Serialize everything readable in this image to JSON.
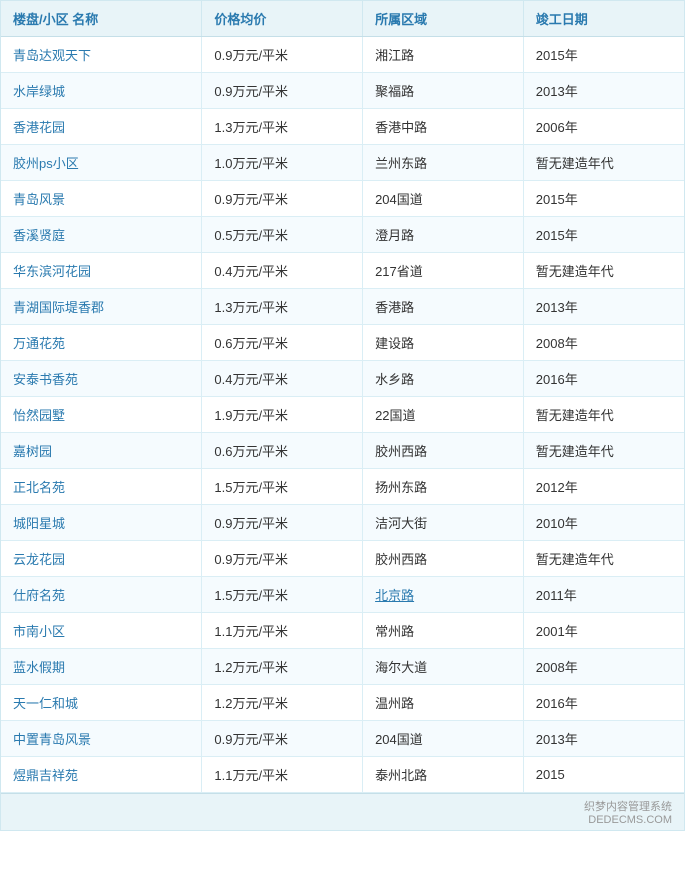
{
  "table": {
    "headers": [
      "楼盘/小区 名称",
      "价格均价",
      "所属区域",
      "竣工日期"
    ],
    "rows": [
      {
        "name": "青岛达观天下",
        "price": "0.9万元/平米",
        "area": "湘江路",
        "year": "2015年"
      },
      {
        "name": "水岸绿城",
        "price": "0.9万元/平米",
        "area": "聚福路",
        "year": "2013年"
      },
      {
        "name": "香港花园",
        "price": "1.3万元/平米",
        "area": "香港中路",
        "year": "2006年"
      },
      {
        "name": "胶州ps小区",
        "price": "1.0万元/平米",
        "area": "兰州东路",
        "year": "暂无建造年代"
      },
      {
        "name": "青岛风景",
        "price": "0.9万元/平米",
        "area": "204国道",
        "year": "2015年"
      },
      {
        "name": "香溪贤庭",
        "price": "0.5万元/平米",
        "area": "澄月路",
        "year": "2015年"
      },
      {
        "name": "华东滨河花园",
        "price": "0.4万元/平米",
        "area": "217省道",
        "year": "暂无建造年代"
      },
      {
        "name": "青湖国际堤香郡",
        "price": "1.3万元/平米",
        "area": "香港路",
        "year": "2013年"
      },
      {
        "name": "万通花苑",
        "price": "0.6万元/平米",
        "area": "建设路",
        "year": "2008年"
      },
      {
        "name": "安泰书香苑",
        "price": "0.4万元/平米",
        "area": "水乡路",
        "year": "2016年"
      },
      {
        "name": "怡然园墅",
        "price": "1.9万元/平米",
        "area": "22国道",
        "year": "暂无建造年代"
      },
      {
        "name": "嘉树园",
        "price": "0.6万元/平米",
        "area": "胶州西路",
        "year": "暂无建造年代"
      },
      {
        "name": "正北名苑",
        "price": "1.5万元/平米",
        "area": "扬州东路",
        "year": "2012年"
      },
      {
        "name": "城阳星城",
        "price": "0.9万元/平米",
        "area": "洁河大街",
        "year": "2010年"
      },
      {
        "name": "云龙花园",
        "price": "0.9万元/平米",
        "area": "胶州西路",
        "year": "暂无建造年代"
      },
      {
        "name": "仕府名苑",
        "price": "1.5万元/平米",
        "area": "北京路",
        "year": "2011年"
      },
      {
        "name": "市南小区",
        "price": "1.1万元/平米",
        "area": "常州路",
        "year": "2001年"
      },
      {
        "name": "蓝水假期",
        "price": "1.2万元/平米",
        "area": "海尔大道",
        "year": "2008年"
      },
      {
        "name": "天一仁和城",
        "price": "1.2万元/平米",
        "area": "温州路",
        "year": "2016年"
      },
      {
        "name": "中置青岛风景",
        "price": "0.9万元/平米",
        "area": "204国道",
        "year": "2013年"
      },
      {
        "name": "煜鼎吉祥苑",
        "price": "1.1万元/平米",
        "area": "泰州北路",
        "year": "2015"
      }
    ],
    "footer": "织梦内容管理系统\nDEDECMS.COM"
  }
}
